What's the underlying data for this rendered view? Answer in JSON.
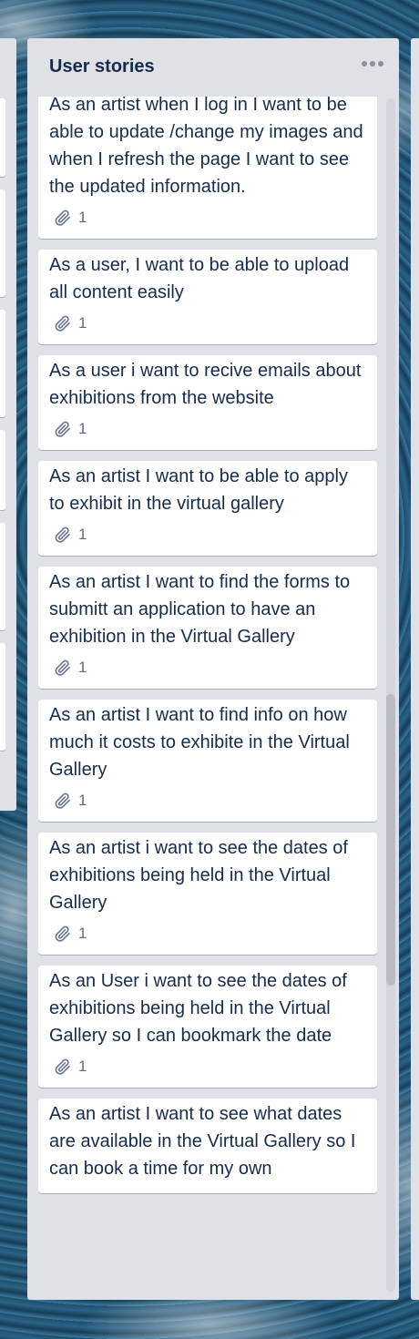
{
  "list": {
    "title": "User stories",
    "menu_icon": "more-horizontal-icon"
  },
  "cards": [
    {
      "text": "As an artist when I log in I want to be able to update /change my images and when I refresh the page I want to see the updated information.",
      "attachments": "1"
    },
    {
      "text": "As a user, I want to be able to upload all content easily",
      "attachments": "1"
    },
    {
      "text": "As a user i want to recive emails about exhibitions from the website",
      "attachments": "1"
    },
    {
      "text": "As an artist I want to be able to apply to exhibit in the virtual gallery",
      "attachments": "1"
    },
    {
      "text": "As an artist I want to find the forms to submitt an application to have an exhibition in the Virtual Gallery",
      "attachments": "1"
    },
    {
      "text": "As an artist I want to find info on how much it costs to exhibite in the Virtual Gallery",
      "attachments": "1"
    },
    {
      "text": "As an artist i want to see the dates of exhibitions being held in the Virtual Gallery",
      "attachments": "1"
    },
    {
      "text": "As an User i want to see the dates of exhibitions being held in the Virtual Gallery so I can bookmark the date",
      "attachments": "1"
    },
    {
      "text": "As an artist I want to see what dates are available in the Virtual Gallery so I can book a time for my own",
      "attachments": ""
    }
  ]
}
